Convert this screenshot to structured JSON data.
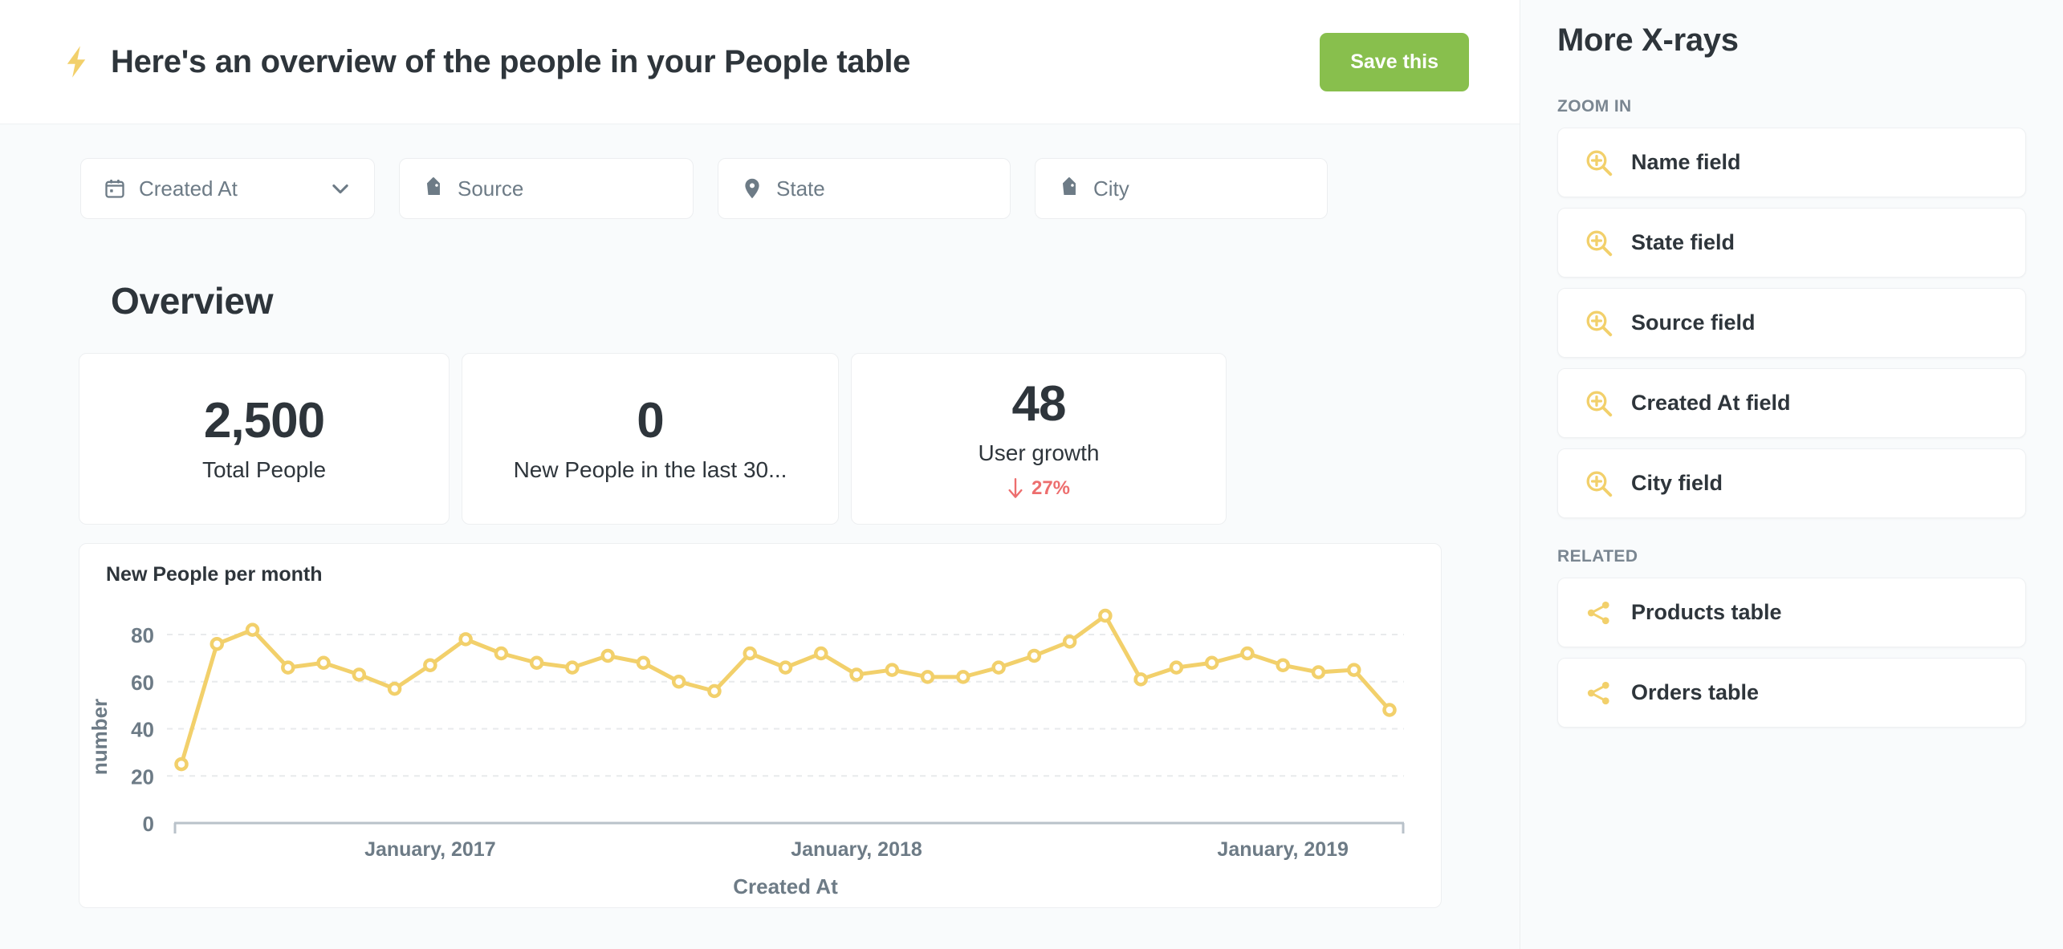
{
  "header": {
    "icon": "lightning-bolt-icon",
    "title": "Here's an overview of the people in your People table",
    "save_label": "Save this",
    "save_color": "#88bf4d"
  },
  "filters": [
    {
      "label": "Created At",
      "icon": "calendar-icon",
      "has_chevron": true
    },
    {
      "label": "Source",
      "icon": "tag-icon",
      "has_chevron": false
    },
    {
      "label": "State",
      "icon": "map-pin-icon",
      "has_chevron": false
    },
    {
      "label": "City",
      "icon": "tag-icon",
      "has_chevron": false
    }
  ],
  "overview": {
    "heading": "Overview",
    "cards": [
      {
        "value": "2,500",
        "label": "Total People"
      },
      {
        "value": "0",
        "label": "New People in the last 30..."
      },
      {
        "value": "48",
        "label": "User growth",
        "delta": "27%",
        "delta_direction": "down",
        "delta_color": "#ed6e6e"
      }
    ]
  },
  "chart_data": {
    "type": "line",
    "title": "New People per month",
    "xlabel": "Created At",
    "ylabel": "number",
    "ylim": [
      0,
      92
    ],
    "yticks": [
      0,
      20,
      40,
      60,
      80
    ],
    "grid": true,
    "legend": false,
    "line_color": "#f2d06b",
    "marker": "open-circle",
    "xtick_labels": [
      "January, 2017",
      "January, 2018",
      "January, 2019"
    ],
    "xtick_positions": [
      7,
      19,
      31
    ],
    "values": [
      25,
      76,
      82,
      66,
      68,
      63,
      57,
      67,
      78,
      72,
      68,
      66,
      71,
      68,
      60,
      56,
      72,
      66,
      72,
      63,
      65,
      62,
      62,
      66,
      71,
      77,
      88,
      61,
      66,
      68,
      72,
      67,
      64,
      65,
      48
    ],
    "x_index": [
      0,
      1,
      2,
      3,
      4,
      5,
      6,
      7,
      8,
      9,
      10,
      11,
      12,
      13,
      14,
      15,
      16,
      17,
      18,
      19,
      20,
      21,
      22,
      23,
      24,
      25,
      26,
      27,
      28,
      29,
      30,
      31,
      32,
      33,
      34
    ]
  },
  "sidebar": {
    "title": "More X-rays",
    "sections": [
      {
        "label": "ZOOM IN",
        "items": [
          {
            "label": "Name field",
            "icon": "zoom-in-icon"
          },
          {
            "label": "State field",
            "icon": "zoom-in-icon"
          },
          {
            "label": "Source field",
            "icon": "zoom-in-icon"
          },
          {
            "label": "Created At field",
            "icon": "zoom-in-icon"
          },
          {
            "label": "City field",
            "icon": "zoom-in-icon"
          }
        ]
      },
      {
        "label": "RELATED",
        "items": [
          {
            "label": "Products table",
            "icon": "share-network-icon"
          },
          {
            "label": "Orders table",
            "icon": "share-network-icon"
          }
        ]
      }
    ]
  }
}
